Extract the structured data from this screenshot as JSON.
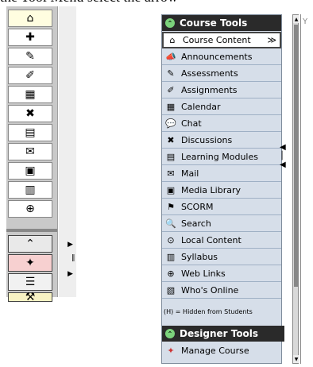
{
  "header_text": "the Tool Menu select the arrow",
  "course_tools": {
    "title": "Course Tools",
    "items": [
      {
        "label": "Course Content",
        "icon": "home-icon"
      },
      {
        "label": "Announcements",
        "icon": "megaphone-icon"
      },
      {
        "label": "Assessments",
        "icon": "assessments-icon"
      },
      {
        "label": "Assignments",
        "icon": "assignments-icon"
      },
      {
        "label": "Calendar",
        "icon": "calendar-icon"
      },
      {
        "label": "Chat",
        "icon": "chat-icon"
      },
      {
        "label": "Discussions",
        "icon": "pin-icon"
      },
      {
        "label": "Learning Modules",
        "icon": "modules-icon"
      },
      {
        "label": "Mail",
        "icon": "mail-icon"
      },
      {
        "label": "Media Library",
        "icon": "media-library-icon"
      },
      {
        "label": "SCORM",
        "icon": "scorm-icon"
      },
      {
        "label": "Search",
        "icon": "search-icon"
      },
      {
        "label": "Local Content",
        "icon": "local-content-icon"
      },
      {
        "label": "Syllabus",
        "icon": "syllabus-icon"
      },
      {
        "label": "Web Links",
        "icon": "web-links-icon"
      },
      {
        "label": "Who's Online",
        "icon": "whos-online-icon"
      }
    ],
    "hidden_note": "(H) = Hidden from Students"
  },
  "designer_tools": {
    "title": "Designer Tools",
    "items": [
      {
        "label": "Manage Course",
        "icon": "manage-course-icon"
      }
    ]
  },
  "left_icons": [
    "home-icon",
    "add-icon",
    "assessments-icon",
    "assignments-icon",
    "calendar-icon",
    "pin-icon",
    "modules-icon",
    "mail-icon",
    "media-icon",
    "syllabus-icon",
    "web-icon"
  ],
  "left_icons_lower": [
    "collapse-icon",
    "manage-icon",
    "list-icon",
    "tools-icon"
  ],
  "right_tab_letter": "Y",
  "dropdown_marker": "≫"
}
